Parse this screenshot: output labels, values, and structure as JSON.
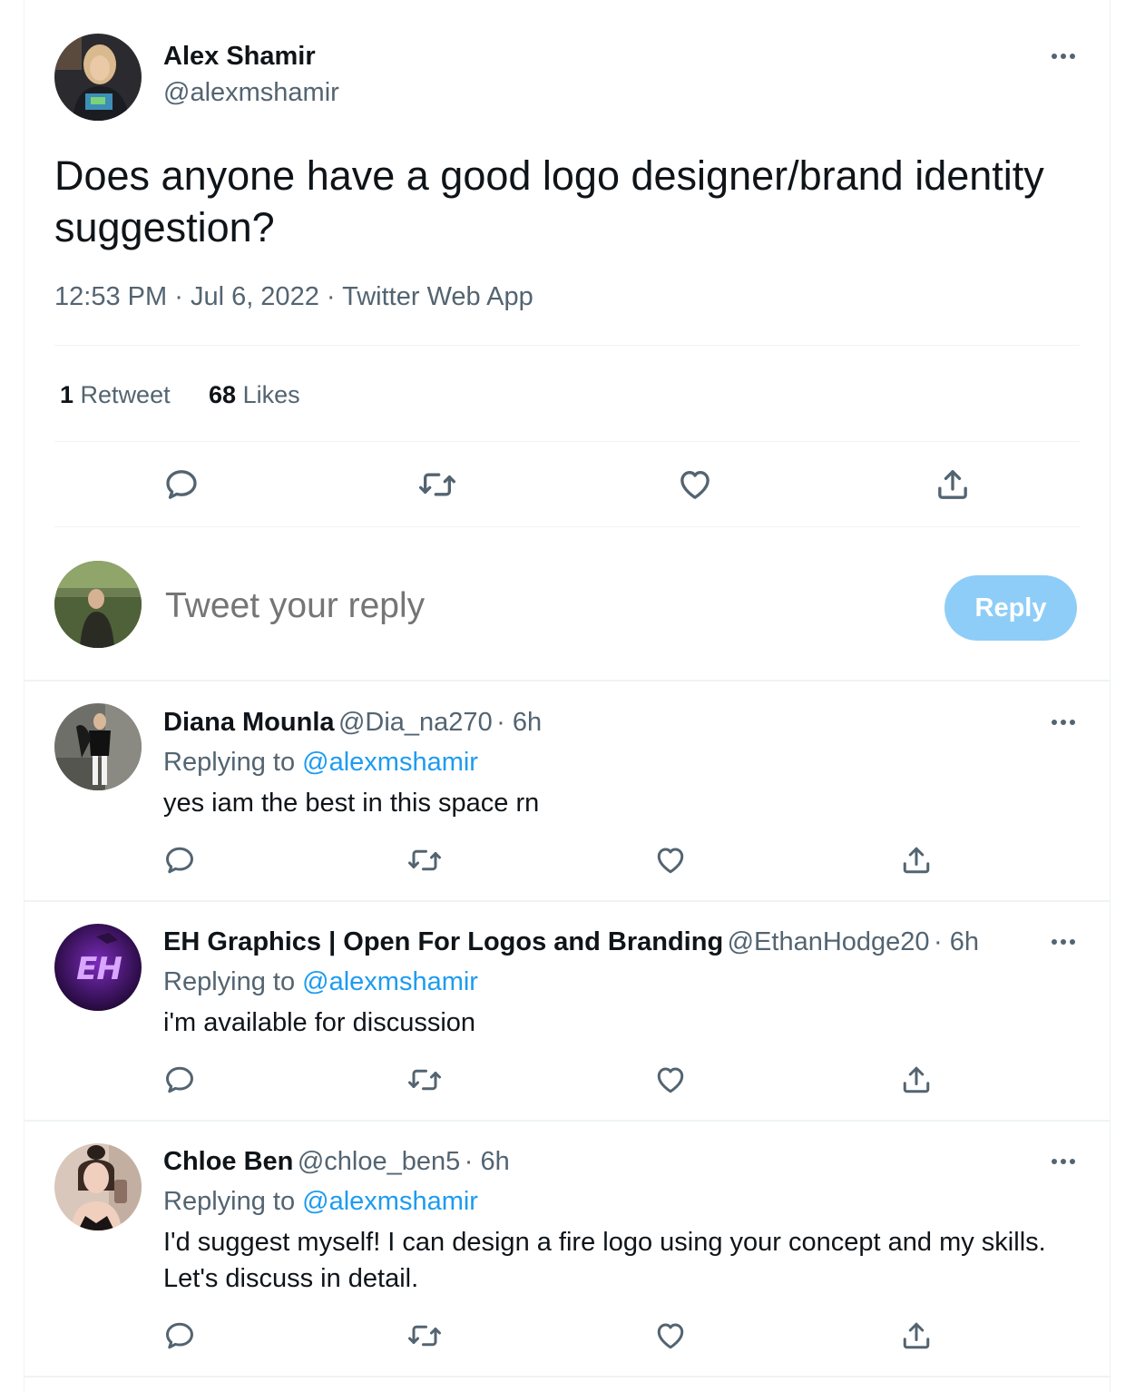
{
  "main_tweet": {
    "author_name": "Alex Shamir",
    "author_handle": "@alexmshamir",
    "text": "Does anyone have a good logo designer/brand identity suggestion?",
    "time": "12:53 PM",
    "date": "Jul 6, 2022",
    "source": "Twitter Web App",
    "dot": "·",
    "retweet_count": "1",
    "retweet_label": "Retweet",
    "like_count": "68",
    "like_label": "Likes"
  },
  "composer": {
    "placeholder": "Tweet your reply",
    "button_label": "Reply"
  },
  "replies": [
    {
      "name": "Diana Mounla",
      "handle": "@Dia_na270",
      "age": "· 6h",
      "replying_prefix": "Replying to",
      "replying_to": "@alexmshamir",
      "text": "yes iam the best in this space rn"
    },
    {
      "name": "EH Graphics | Open For Logos and Branding",
      "handle": "@EthanHodge20",
      "age": "· 6h",
      "replying_prefix": "Replying to",
      "replying_to": "@alexmshamir",
      "text": "i'm available for discussion",
      "avatar_text": "EH"
    },
    {
      "name": "Chloe Ben",
      "handle": "@chloe_ben5",
      "age": "· 6h",
      "replying_prefix": "Replying to",
      "replying_to": "@alexmshamir",
      "text_line1": "I'd suggest myself! I can design a fire logo using your concept and my skills.",
      "text_line2": "Let's discuss in detail."
    }
  ],
  "icons": [
    "more-icon",
    "reply-icon",
    "retweet-icon",
    "like-icon",
    "share-icon"
  ],
  "colors": {
    "link": "#1d9bf0",
    "secondary": "#536471",
    "reply_button": "#8ecdf8",
    "divider": "#eff3f4"
  }
}
